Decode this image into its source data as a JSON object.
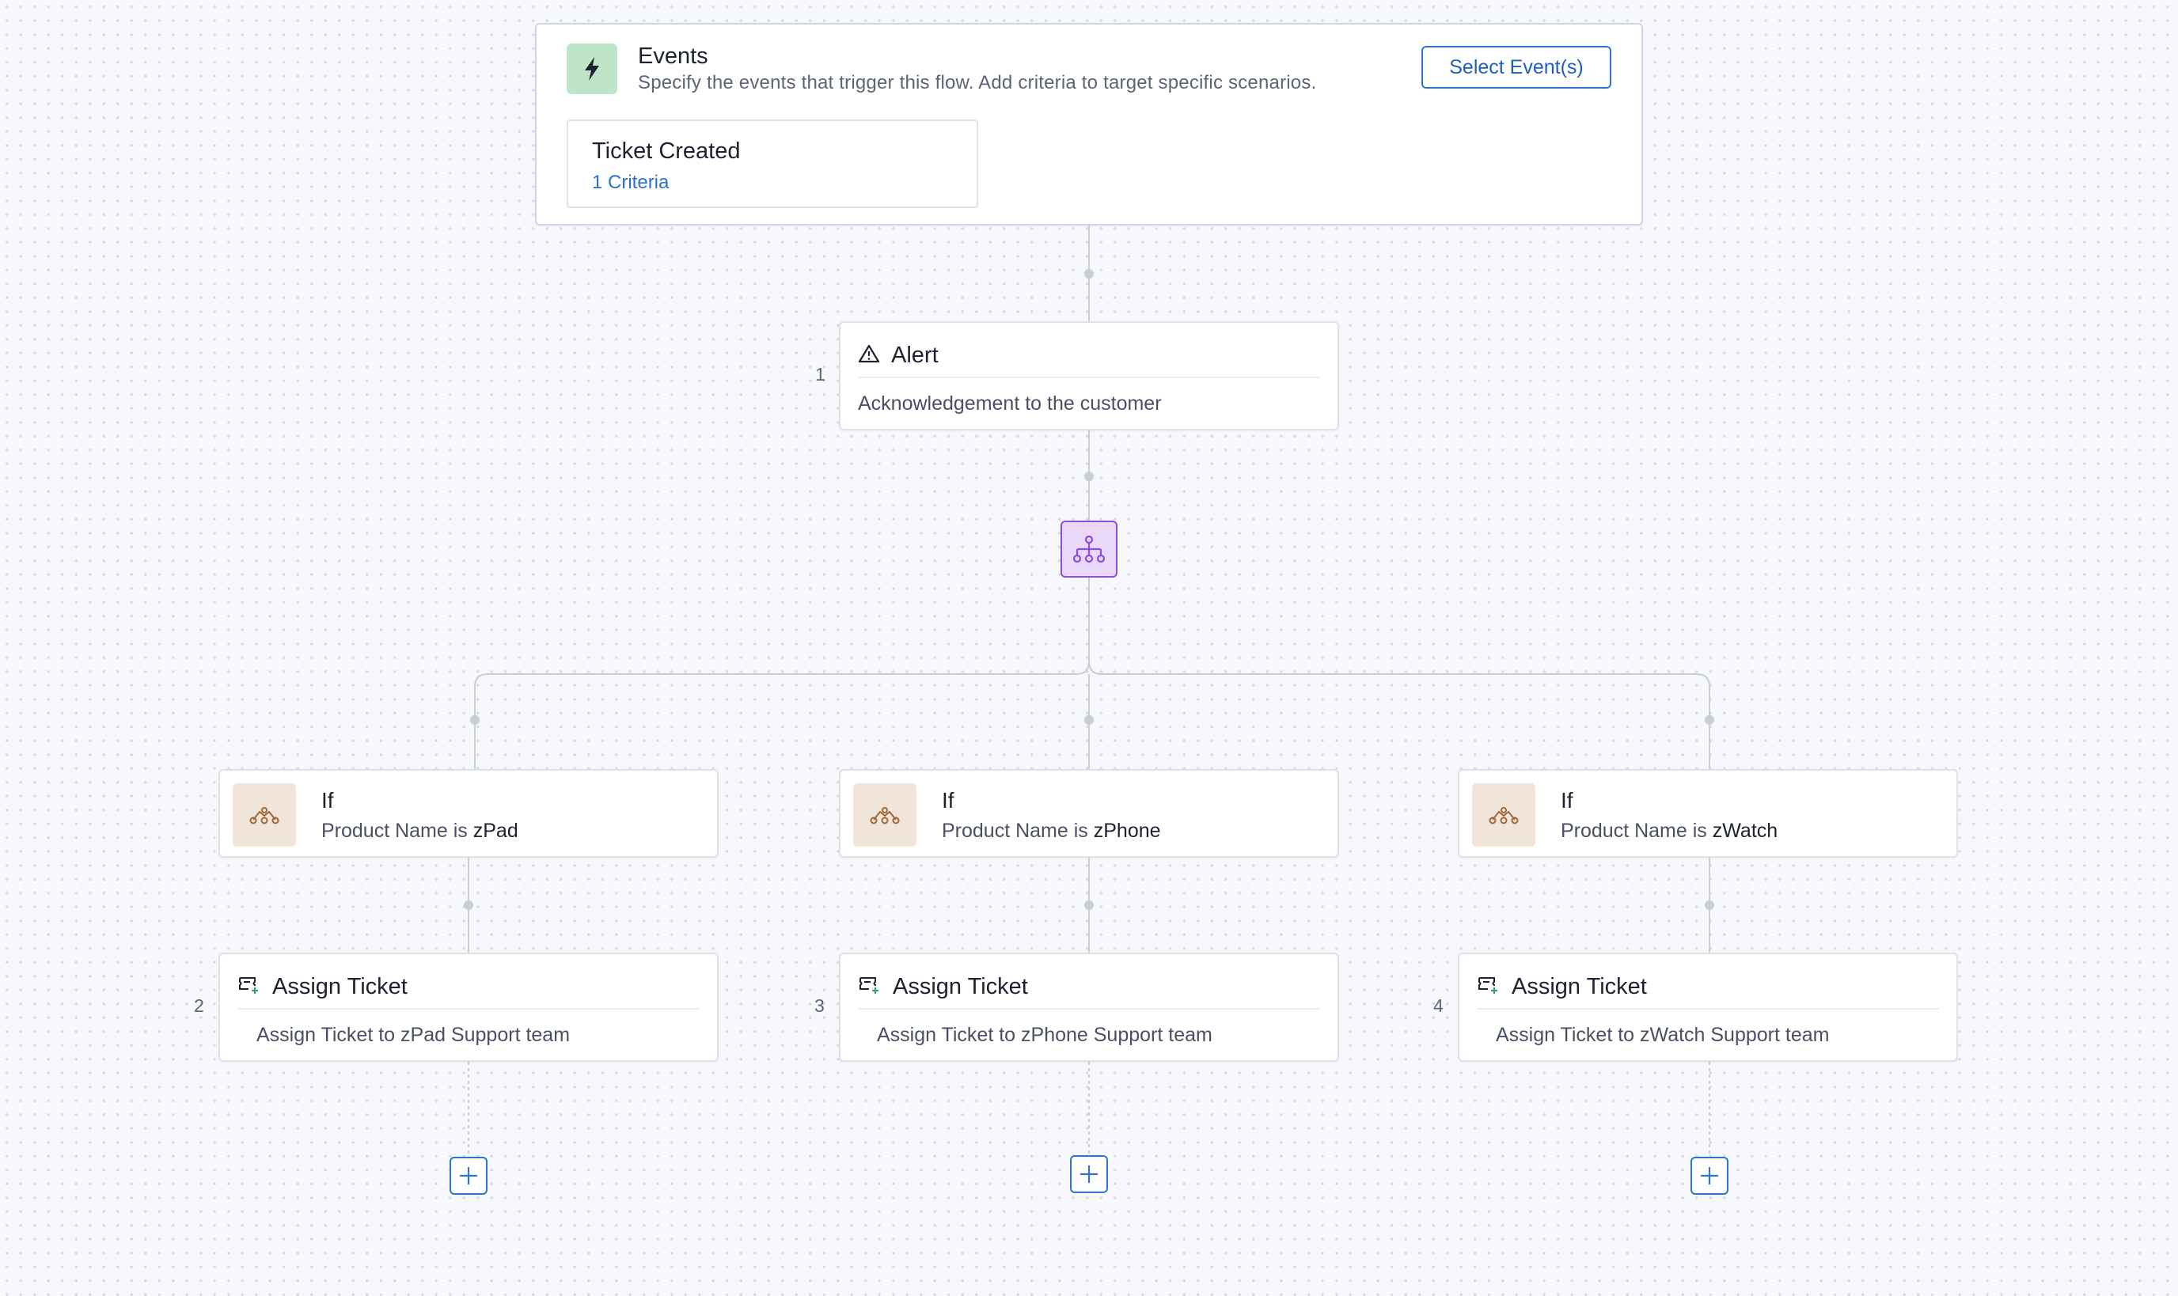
{
  "events": {
    "title": "Events",
    "description": "Specify the events that trigger this flow. Add criteria to target specific scenarios.",
    "select_button": "Select Event(s)",
    "trigger": {
      "name": "Ticket Created",
      "criteria": "1 Criteria"
    },
    "icon": "lightning-icon",
    "accent_color": "#bfe5c9"
  },
  "alert": {
    "step": "1",
    "title": "Alert",
    "description": "Acknowledgement to the customer",
    "icon": "warning-triangle-icon"
  },
  "branch": {
    "icon": "branch-hierarchy-icon",
    "color": "#8a4fd8"
  },
  "conditions": [
    {
      "title": "If",
      "prefix": "Product Name is",
      "value": "zPad"
    },
    {
      "title": "If",
      "prefix": "Product Name is",
      "value": "zPhone"
    },
    {
      "title": "If",
      "prefix": "Product Name is",
      "value": "zWatch"
    }
  ],
  "assign_actions": [
    {
      "step": "2",
      "title": "Assign Ticket",
      "description": "Assign Ticket to zPad Support team"
    },
    {
      "step": "3",
      "title": "Assign Ticket",
      "description": "Assign Ticket to zPhone Support team"
    },
    {
      "step": "4",
      "title": "Assign Ticket",
      "description": "Assign Ticket to zWatch Support team"
    }
  ],
  "colors": {
    "primary": "#2f74d0",
    "connector": "#c9cdd8"
  }
}
